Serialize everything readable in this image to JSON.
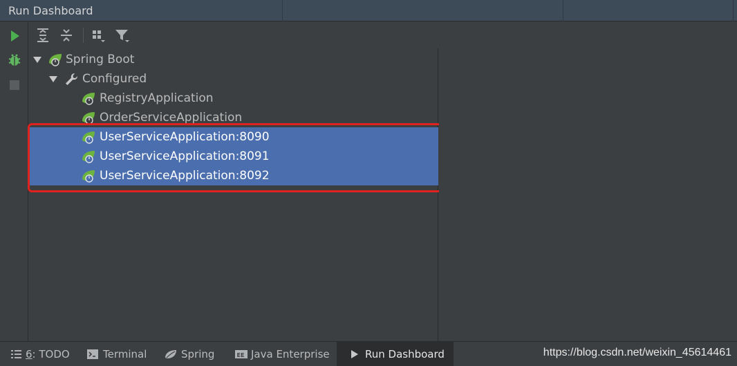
{
  "window": {
    "title": "Run Dashboard"
  },
  "left_actions": [
    {
      "icon": "run-icon",
      "color": "#4caf50"
    },
    {
      "icon": "debug-icon",
      "color": "#5fb760"
    },
    {
      "icon": "stop-icon",
      "color": "#5a5d5f"
    }
  ],
  "toolbar": {
    "buttons": [
      "expand-all-icon",
      "collapse-all-icon",
      "group-by-icon",
      "filter-icon"
    ]
  },
  "tree": {
    "root": {
      "label": "Spring Boot",
      "icon": "spring-boot-icon",
      "expanded": true
    },
    "group": {
      "label": "Configured",
      "icon": "wrench-icon",
      "expanded": true
    },
    "apps": [
      {
        "label": "RegistryApplication",
        "selected": false
      },
      {
        "label": "OrderServiceApplication",
        "selected": false
      },
      {
        "label": "UserServiceApplication:8090",
        "selected": true
      },
      {
        "label": "UserServiceApplication:8091",
        "selected": true
      },
      {
        "label": "UserServiceApplication:8092",
        "selected": true
      }
    ]
  },
  "bottom_bar": {
    "todo": {
      "mnemonic": "6",
      "label": ": TODO"
    },
    "terminal": {
      "label": "Terminal"
    },
    "spring": {
      "label": "Spring"
    },
    "java_enterprise": {
      "label": "Java Enterprise"
    },
    "run_dashboard": {
      "label": "Run Dashboard",
      "active": true
    }
  },
  "watermark": "https://blog.csdn.net/weixin_45614461",
  "colors": {
    "selection": "#4b6eaf",
    "highlight_box": "#e0221e",
    "spring_green": "#6db33f",
    "panel_bg": "#3c3f41"
  }
}
